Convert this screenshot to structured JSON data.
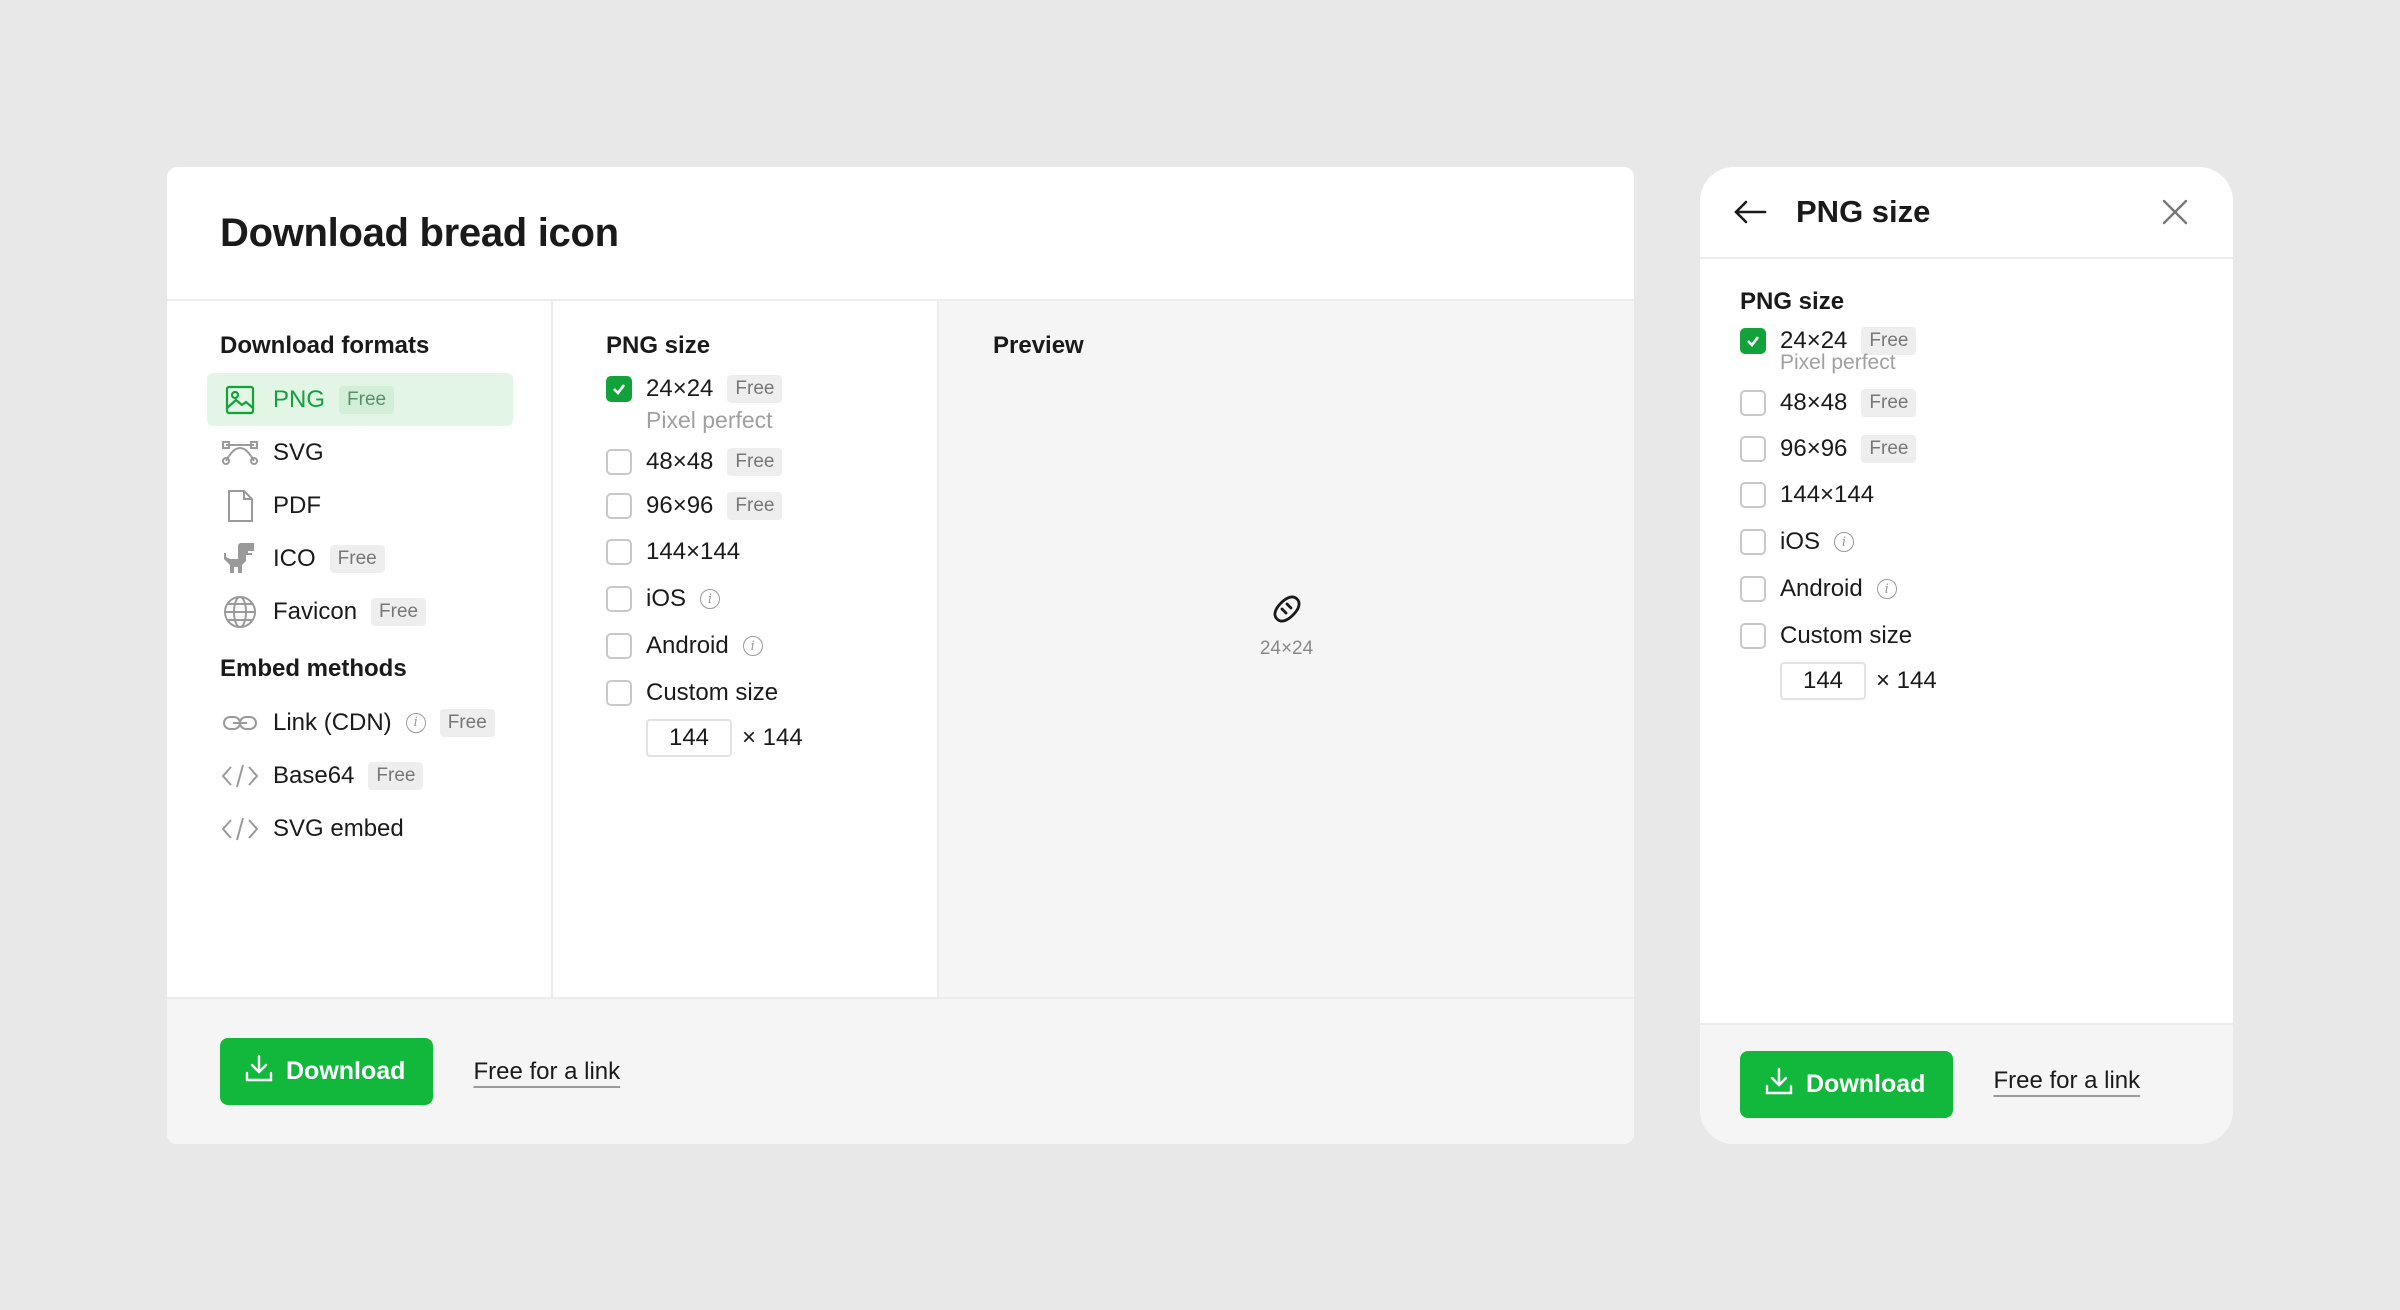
{
  "dialog": {
    "title": "Download bread icon",
    "formats_title": "Download formats",
    "formats": [
      {
        "label": "PNG",
        "badge": "Free",
        "icon": "image-icon",
        "active": true
      },
      {
        "label": "SVG",
        "badge": "",
        "icon": "bezier-icon",
        "active": false
      },
      {
        "label": "PDF",
        "badge": "",
        "icon": "file-icon",
        "active": false
      },
      {
        "label": "ICO",
        "badge": "Free",
        "icon": "dino-icon",
        "active": false
      },
      {
        "label": "Favicon",
        "badge": "Free",
        "icon": "globe-icon",
        "active": false
      }
    ],
    "embed_title": "Embed methods",
    "embeds": [
      {
        "label": "Link (CDN)",
        "badge": "Free",
        "icon": "link-icon"
      },
      {
        "label": "Base64",
        "badge": "Free",
        "icon": "code-icon"
      },
      {
        "label": "SVG embed",
        "badge": "",
        "icon": "code-icon"
      }
    ],
    "sizes_title": "PNG size",
    "preview_title": "Preview",
    "preview_label": "24×24",
    "footer": {
      "download": "Download",
      "free_link": "Free for a link"
    }
  },
  "sizes": [
    {
      "label": "24×24",
      "badge": "Free",
      "checked": true,
      "sub": "Pixel perfect"
    },
    {
      "label": "48×48",
      "badge": "Free",
      "checked": false
    },
    {
      "label": "96×96",
      "badge": "Free",
      "checked": false
    },
    {
      "label": "144×144",
      "badge": "",
      "checked": false
    },
    {
      "label": "iOS",
      "badge": "",
      "checked": false,
      "info": true
    },
    {
      "label": "Android",
      "badge": "",
      "checked": false,
      "info": true
    },
    {
      "label": "Custom size",
      "badge": "",
      "checked": false
    }
  ],
  "custom": {
    "value": "144",
    "suffix": "× 144"
  },
  "panel": {
    "title": "PNG size",
    "section_title": "PNG size",
    "footer": {
      "download": "Download",
      "free_link": "Free for a link"
    }
  },
  "colors": {
    "accent": "#11b83c",
    "accent_text": "#11a23a",
    "active_bg": "#e3f6e6"
  }
}
